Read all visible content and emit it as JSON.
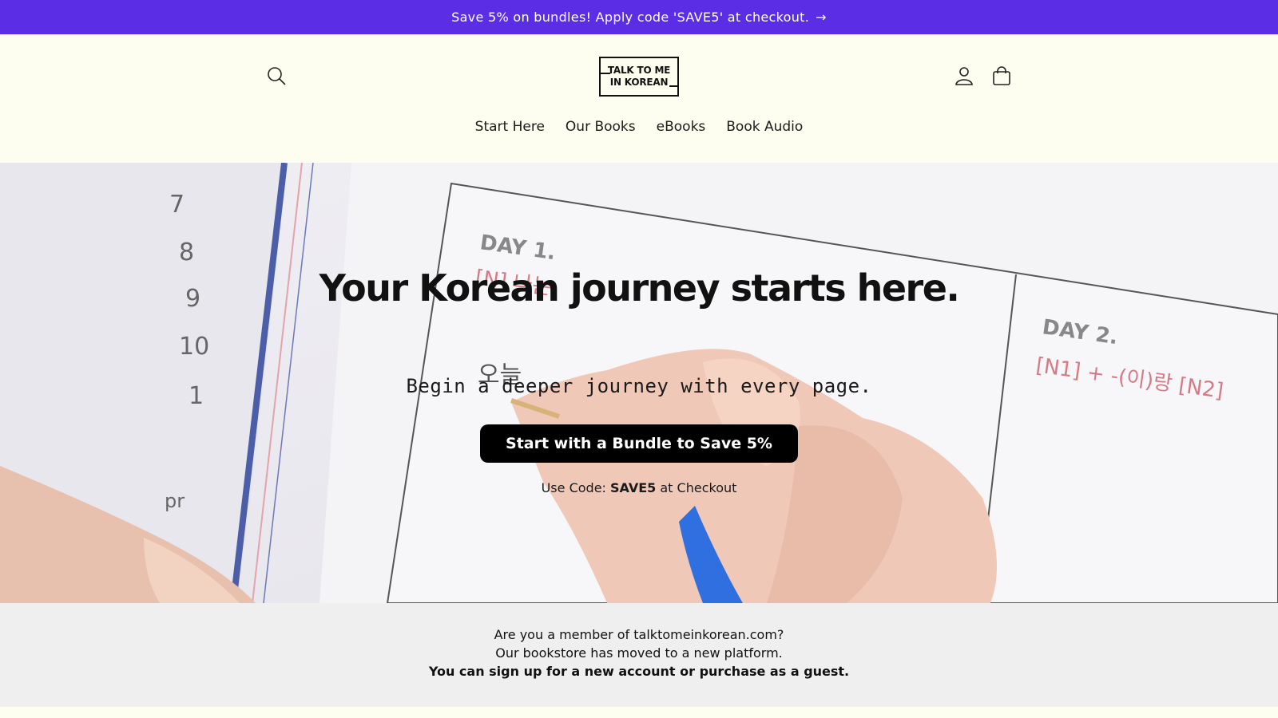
{
  "announcement": {
    "text": "Save 5% on bundles! Apply code 'SAVE5' at checkout.",
    "arrow": "→"
  },
  "header": {
    "logo_line1": "TALK TO ME",
    "logo_line2": "IN KOREAN",
    "icons": [
      "search-icon",
      "account-icon",
      "cart-icon"
    ]
  },
  "nav": {
    "items": [
      "Start Here",
      "Our Books",
      "eBooks",
      "Book Audio"
    ]
  },
  "hero": {
    "title": "Your Korean journey starts here.",
    "subtitle": "Begin a deeper journey with every page.",
    "cta_label": "Start with a Bundle to Save 5%",
    "code_prefix": "Use Code:",
    "code": "SAVE5",
    "code_suffix": "at Checkout",
    "image": {
      "margin_numbers": [
        "7",
        "8",
        "9",
        "10",
        "1"
      ],
      "day1": "DAY 1.",
      "day1_pattern": "[N] 나는",
      "day2": "DAY 2.",
      "day2_pattern": "[N1] + -(이)랑 [N2]",
      "handwriting": "오늘",
      "corner_text": "pr"
    }
  },
  "notice": {
    "line1": "Are you a member of talktomeinkorean.com?",
    "line2": "Our bookstore has moved to a new platform.",
    "line3": "You can sign up for a new account or purchase as a guest."
  },
  "colors": {
    "announcement_bg": "#5b2ee6",
    "header_bg": "#fefef0",
    "cta_bg": "#000000",
    "notice_bg": "#efefef"
  }
}
